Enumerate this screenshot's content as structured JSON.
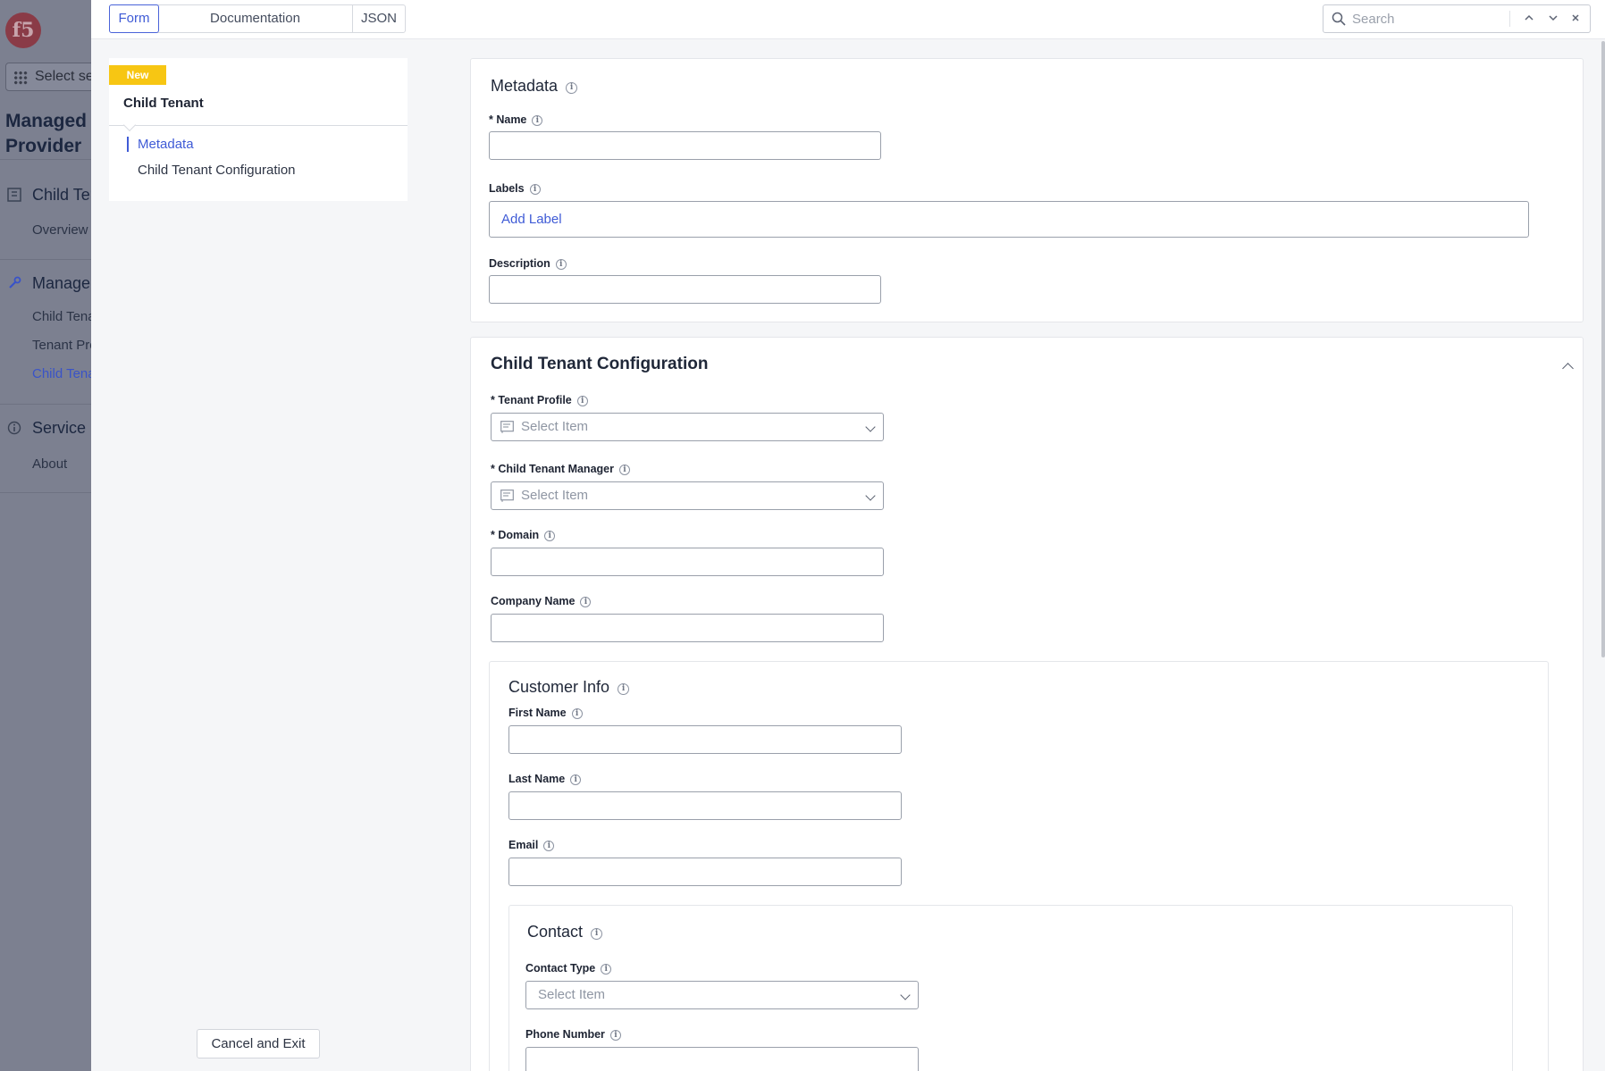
{
  "background_app": {
    "logo": "f5",
    "select_service": "Select service",
    "workspace_title_line1": "Managed Service",
    "workspace_title_line2": "Provider",
    "sections": [
      {
        "label": "Child Tenants",
        "items": [
          "Overview"
        ]
      },
      {
        "label": "Manage",
        "items": [
          "Child Tenants",
          "Tenant Profiles",
          "Child Tenant Managers"
        ]
      },
      {
        "label": "Service Info",
        "items": [
          "About"
        ]
      }
    ],
    "active_item": "Child Tenant Managers"
  },
  "topbar": {
    "tabs": [
      "Form",
      "Documentation",
      "JSON"
    ],
    "active_tab": "Form",
    "search_placeholder": "Search"
  },
  "nav": {
    "badge": "New",
    "title": "Child Tenant",
    "links": [
      "Metadata",
      "Child Tenant Configuration"
    ],
    "active_link": "Metadata",
    "cancel_label": "Cancel and Exit"
  },
  "metadata": {
    "title": "Metadata",
    "name_label": "* Name",
    "name_value": "",
    "labels_label": "Labels",
    "add_label": "Add Label",
    "description_label": "Description",
    "description_value": ""
  },
  "config": {
    "title": "Child Tenant Configuration",
    "tenant_profile_label": "* Tenant Profile",
    "tenant_profile_placeholder": "Select Item",
    "manager_label": "* Child Tenant Manager",
    "manager_placeholder": "Select Item",
    "domain_label": "* Domain",
    "domain_value": "",
    "company_label": "Company Name",
    "company_value": "",
    "customer": {
      "title": "Customer Info",
      "first_name_label": "First Name",
      "last_name_label": "Last Name",
      "email_label": "Email",
      "contact": {
        "title": "Contact",
        "contact_type_label": "Contact Type",
        "contact_type_placeholder": "Select Item",
        "phone_label": "Phone Number"
      }
    }
  }
}
